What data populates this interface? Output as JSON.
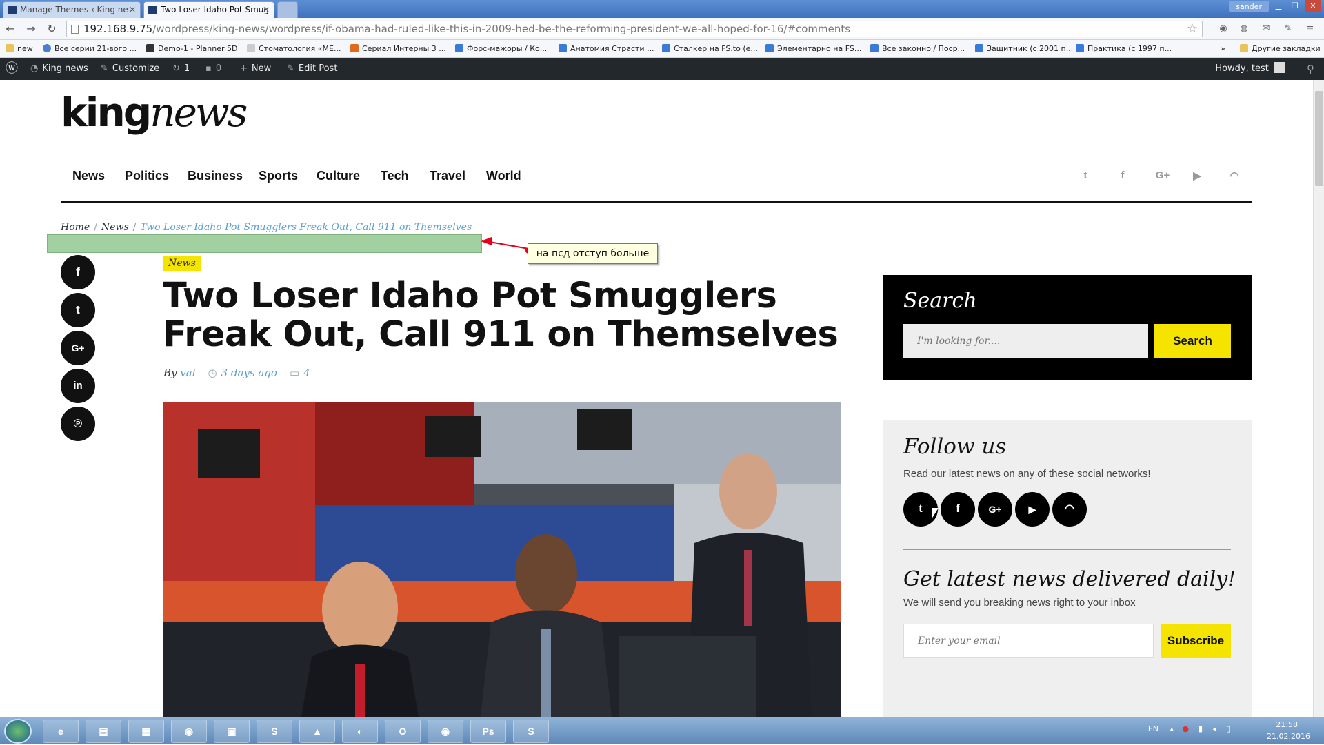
{
  "browser": {
    "tabs": [
      {
        "label": "Manage Themes ‹ King ne"
      },
      {
        "label": "Two Loser Idaho Pot Smug"
      }
    ],
    "user_label": "sander",
    "url_host": "192.168.9.75",
    "url_path": "/wordpress/king-news/wordpress/if-obama-had-ruled-like-this-in-2009-hed-be-the-reforming-president-we-all-hoped-for-16/#comments",
    "bookmarks": [
      "new",
      "Все серии 21-вого ...",
      "Demo-1 - Planner 5D",
      "Стоматология «МЕ...",
      "Сериал Интерны 3 ...",
      "Форс-мажоры / Ко...",
      "Анатомия Страсти ...",
      "Сталкер на FS.to (е...",
      "Элементарно на FS...",
      "Все законно / Поср...",
      "Защитник (с 2001 п...",
      "Практика (с 1997 п..."
    ],
    "bookmarks_more": "»",
    "other_bookmarks": "Другие закладки"
  },
  "wp_admin_bar": {
    "site_name": "King news",
    "customize": "Customize",
    "updates_count": "1",
    "comments_count": "0",
    "new_label": "New",
    "edit_post": "Edit Post",
    "howdy": "Howdy, test"
  },
  "site": {
    "logo_bold": "king",
    "logo_italic": "news",
    "nav": [
      "News",
      "Politics",
      "Business",
      "Sports",
      "Culture",
      "Tech",
      "Travel",
      "World"
    ],
    "header_social_icons": [
      "twitter-icon",
      "facebook-icon",
      "google-plus-icon",
      "youtube-icon",
      "rss-icon"
    ],
    "breadcrumb": {
      "home": "Home",
      "sep": "/",
      "section": "News",
      "current": "Two Loser Idaho Pot Smugglers Freak Out, Call 911 on Themselves"
    },
    "annotation_note": "на псд отступ больше",
    "share_icons": [
      "facebook-icon",
      "twitter-icon",
      "google-plus-icon",
      "linkedin-icon",
      "pinterest-icon"
    ],
    "article": {
      "category": "News",
      "title": "Two Loser Idaho Pot Smugglers Freak Out, Call 911 on Themselves",
      "by": "By",
      "author": "val",
      "date": "3 days ago",
      "comments": "4"
    },
    "sidebar": {
      "search_title": "Search",
      "search_placeholder": "I'm looking for....",
      "search_button": "Search",
      "follow_title": "Follow us",
      "follow_text": "Read our latest news on any of these social networks!",
      "follow_icons": [
        "twitter-icon",
        "facebook-icon",
        "google-plus-icon",
        "youtube-icon",
        "rss-icon"
      ],
      "newsletter_title": "Get latest news delivered daily!",
      "newsletter_text": "We will send you breaking news right to your inbox",
      "email_placeholder": "Enter your email",
      "subscribe_button": "Subscribe"
    }
  },
  "taskbar": {
    "lang": "EN",
    "time": "21:58",
    "date": "21.02.2016"
  },
  "colors": {
    "accent_yellow": "#f4e400",
    "link_blue": "#5aa0d2",
    "admin_bar": "#23282d"
  }
}
